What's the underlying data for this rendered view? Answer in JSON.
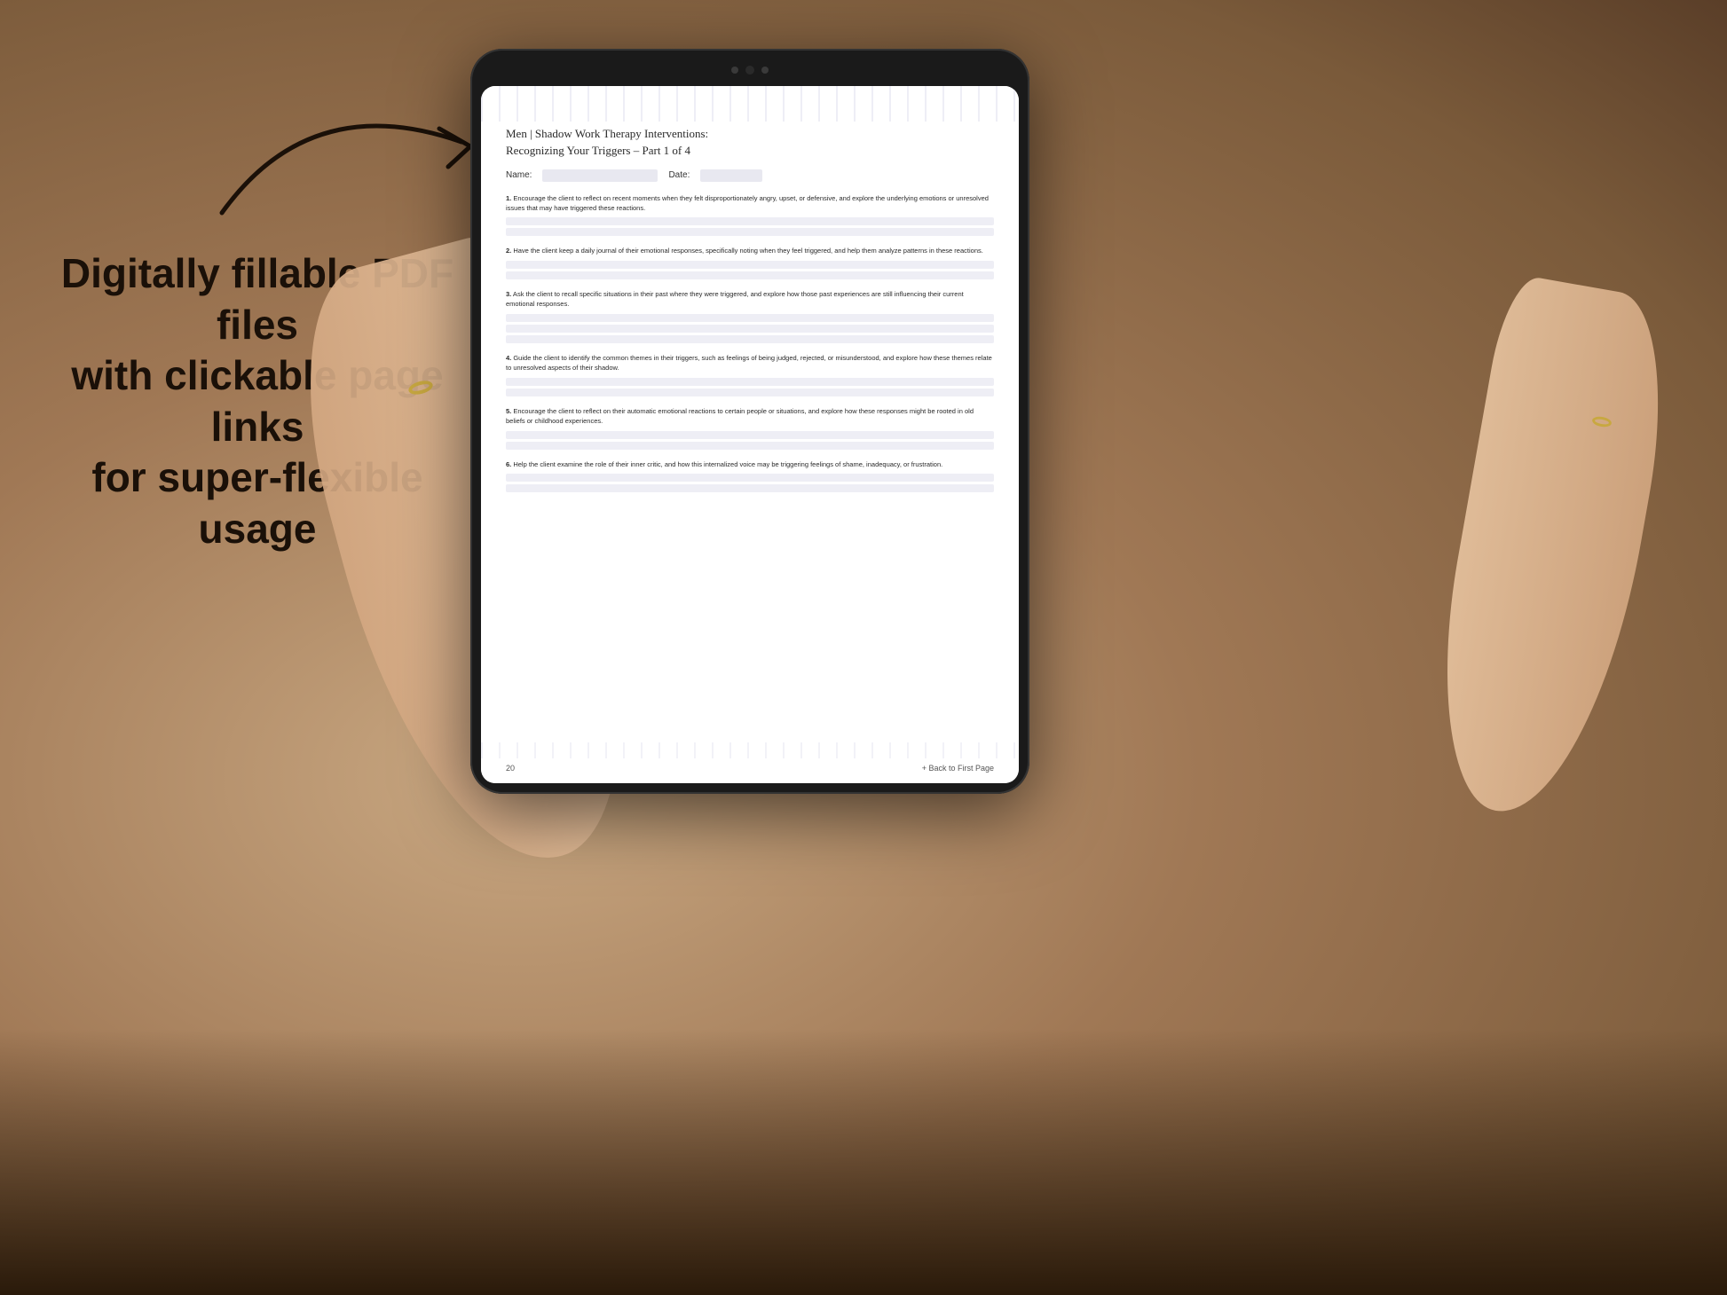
{
  "background": {
    "color": "#b8967a"
  },
  "left_text": {
    "line1": "Digitally fillable PDF files",
    "line2": "with clickable page links",
    "line3": "for super-flexible usage"
  },
  "tablet": {
    "screen_bg": "#ffffff"
  },
  "pdf": {
    "title": "Men | Shadow Work Therapy Interventions:",
    "subtitle": "Recognizing Your Triggers  – Part 1 of 4",
    "name_label": "Name:",
    "date_label": "Date:",
    "items": [
      {
        "number": "1.",
        "text": "Encourage the client to reflect on recent moments when they felt disproportionately angry, upset, or defensive, and explore the underlying emotions or unresolved issues that may have triggered these reactions."
      },
      {
        "number": "2.",
        "text": "Have the client keep a daily journal of their emotional responses, specifically noting when they feel triggered, and help them analyze patterns in these reactions."
      },
      {
        "number": "3.",
        "text": "Ask the client to recall specific situations in their past where they were triggered, and explore how those past experiences are still influencing their current emotional responses."
      },
      {
        "number": "4.",
        "text": "Guide the client to identify the common themes in their triggers, such as feelings of being judged, rejected, or misunderstood, and explore how these themes relate to unresolved aspects of their shadow."
      },
      {
        "number": "5.",
        "text": "Encourage the client to reflect on their automatic emotional reactions to certain people or situations, and explore how these responses might be rooted in old beliefs or childhood experiences."
      },
      {
        "number": "6.",
        "text": "Help the client examine the role of their inner critic, and how this internalized voice may be triggering feelings of shame, inadequacy, or frustration."
      }
    ],
    "page_number": "20",
    "back_link": "+ Back to First Page"
  }
}
